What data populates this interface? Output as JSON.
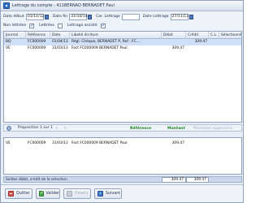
{
  "window": {
    "title": "Lettrage du compte : 411BERNAD   BERNADET Paul"
  },
  "filters": {
    "date_debut_label": "Date début",
    "date_debut_value": "01/11/12",
    "date_fin_label": "Date fin",
    "date_fin_value": "31/10/14",
    "car_lettrage_label": "Car. Lettrage",
    "car_lettrage_value": "",
    "date_lettrage_label": "Date Lettrage",
    "date_lettrage_value": "27/11/13",
    "non_lettrees_label": "Non lettrées",
    "non_lettrees_checked": true,
    "lettrees_label": "Lettrées",
    "lettrees_checked": false,
    "lettrage_assiste_label": "Lettrage assisté",
    "lettrage_assiste_checked": true
  },
  "grid_top": {
    "columns": [
      "Journal",
      "Référence",
      "Date",
      "Libellé écriture",
      "Débit",
      "Crédit",
      "C.L.",
      "Sélectionné"
    ],
    "rows": [
      {
        "journal": "BQ",
        "reference": "FC000009",
        "date": "01/04/13",
        "libelle": "Régl. Chèque, BERNADET P, Ref : FC...",
        "debit": "",
        "credit": "309.47",
        "cl": "",
        "selectionne": ""
      },
      {
        "journal": "VE",
        "reference": "FC000009",
        "date": "31/03/13",
        "libelle": "Fact FC000009 BERNADET Paul",
        "debit": "309.47",
        "credit": "",
        "cl": "",
        "selectionne": ""
      }
    ]
  },
  "nav": {
    "proposition_text": "Proposition  1  sur  1",
    "prev_arrow": "‹",
    "next_arrow": "›",
    "legend_reference": "Référence",
    "legend_montant": "Montant",
    "legend_montant_approche": "Montant approché",
    "colors": {
      "reference": "#1e8a1e",
      "montant": "#1e8a1e",
      "montant_approche": "#c2c9d2"
    }
  },
  "grid_bottom": {
    "rows": [
      {
        "journal": "VE",
        "reference": "FC000009",
        "date": "31/03/13",
        "libelle": "Fact FC000009 BERNADET Paul",
        "debit": "309.47",
        "credit": ""
      }
    ]
  },
  "totals": {
    "label": "Soldes débit, crédit de la sélection",
    "debit": "309.47",
    "credit": "309.47"
  },
  "toolbar": {
    "quit_label": "Quitter",
    "validate_label": "Valider",
    "delete_label": "Délettr.",
    "next_label": "Suivant"
  }
}
